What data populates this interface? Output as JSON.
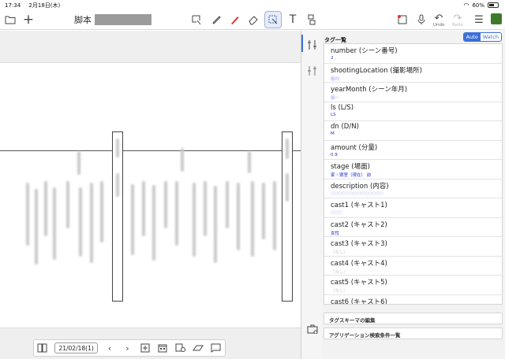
{
  "status_bar": {
    "time": "17:34",
    "date": "2月18日(木)",
    "battery": "60%",
    "battery_level": 0.6
  },
  "toolbar": {
    "doc_title": "脚本",
    "undo_label": "Undo",
    "redo_label": "Redo",
    "accent": "#3b6fd8",
    "avatar_color": "#3d7a2a"
  },
  "bottom_bar": {
    "date": "21/02/18(1)"
  },
  "tag_panel": {
    "header": "タグ一覧",
    "mode_auto": "Auto",
    "mode_watch": "Watch",
    "tags": [
      {
        "name": "number (シーン番号)",
        "value": "2",
        "style": "clear"
      },
      {
        "name": "shootingLocation (撮影場所)",
        "value": "都内",
        "style": "blur"
      },
      {
        "name": "yearMonth (シーン年月)",
        "value": "春〜",
        "style": "blur"
      },
      {
        "name": "ls (L/S)",
        "value": "LS",
        "style": "clear"
      },
      {
        "name": "dn (D/N)",
        "value": "M",
        "style": "clear"
      },
      {
        "name": "amount (分量)",
        "value": "0.9",
        "style": "clear"
      },
      {
        "name": "stage (場面)",
        "value": "家・寝室（現在） 前",
        "style": "clear"
      },
      {
        "name": "description (内容)",
        "value": "○○○○○○○○○○○○○○",
        "style": "blur"
      },
      {
        "name": "cast1 (キャスト1)",
        "value": "○○○",
        "style": "blur"
      },
      {
        "name": "cast2 (キャスト2)",
        "value": "女性",
        "style": "clear"
      },
      {
        "name": "cast3 (キャスト3)",
        "value": "（なし）",
        "style": "ph"
      },
      {
        "name": "cast4 (キャスト4)",
        "value": "（なし）",
        "style": "ph"
      },
      {
        "name": "cast5 (キャスト5)",
        "value": "（なし）",
        "style": "ph"
      },
      {
        "name": "cast6 (キャスト6)",
        "value": "（なし）",
        "style": "ph"
      }
    ],
    "edit_schema_button": "タグスキーマの編集",
    "aggregation_button": "アグリゲーション検索条件一覧"
  }
}
